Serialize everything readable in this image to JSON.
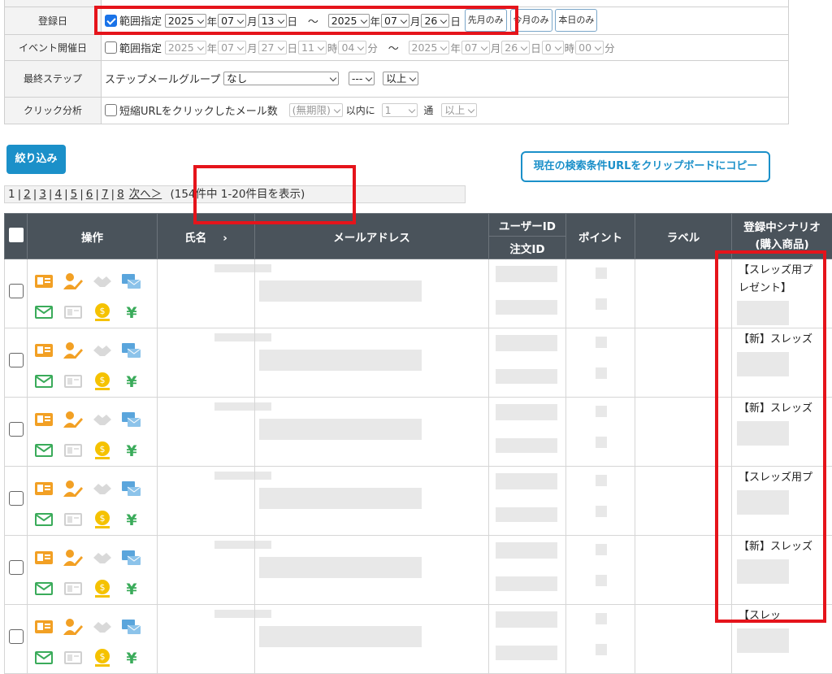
{
  "filters": {
    "reg_label": "登録日",
    "reg_range_label": "範囲指定",
    "reg_from": {
      "year": "2025",
      "month": "07",
      "day": "13"
    },
    "reg_to": {
      "year": "2025",
      "month": "07",
      "day": "26"
    },
    "unit_year": "年",
    "unit_month": "月",
    "unit_day": "日",
    "unit_hour": "時",
    "unit_min": "分",
    "tilde": "～",
    "btn_first_month": "先月のみ",
    "btn_this_month": "今月のみ",
    "btn_today": "本日のみ",
    "event_label": "イベント開催日",
    "event_range_label": "範囲指定",
    "event_from": {
      "year": "2025",
      "month": "07",
      "day": "27",
      "hour": "11",
      "min": "04"
    },
    "event_to": {
      "year": "2025",
      "month": "07",
      "day": "26",
      "hour": "0",
      "min": "00"
    },
    "step_label": "最終ステップ",
    "step_group_label": "ステップメールグループ",
    "step_group_value": "なし",
    "step_num_value": "---",
    "step_cmp_value": "以上",
    "click_label": "クリック分析",
    "click_check_label": "短縮URLをクリックしたメール数",
    "click_period": "(無期限)",
    "click_within": "以内に",
    "click_count": "1",
    "click_unit": "通",
    "click_cmp": "以上"
  },
  "actions": {
    "narrow_label": "絞り込み",
    "copy_url_label": "現在の検索条件URLをクリップボードにコピー"
  },
  "pager": {
    "current": "1",
    "pages": [
      "2",
      "3",
      "4",
      "5",
      "6",
      "7",
      "8"
    ],
    "next_label": "次へ＞",
    "summary": "(154件中 1-20件目を表示)"
  },
  "table": {
    "headers": {
      "ops": "操作",
      "name": "氏名",
      "name_arrow": "›",
      "email": "メールアドレス",
      "user_id": "ユーザーID",
      "order_id": "注文ID",
      "points": "ポイント",
      "label": "ラベル",
      "scenario_1": "登録中シナリオ",
      "scenario_2": "(購入商品)"
    },
    "rows": [
      {
        "scenario_l1": "【スレッズ用プ",
        "scenario_l2": "レゼント】"
      },
      {
        "scenario_l1": "【新】スレッズ",
        "scenario_l2": ""
      },
      {
        "scenario_l1": "【新】スレッズ",
        "scenario_l2": ""
      },
      {
        "scenario_l1": "【スレッズ用プ",
        "scenario_l2": ""
      },
      {
        "scenario_l1": "【新】スレッズ",
        "scenario_l2": ""
      },
      {
        "scenario_l1": "【スレッ",
        "scenario_l2": ""
      }
    ]
  },
  "colors": {
    "header_bg": "#4a535b",
    "primary": "#1b90c9",
    "annotation_red": "#e5141b",
    "icon_orange": "#f2a024",
    "icon_blue": "#5aa5dc",
    "icon_green": "#3aab5a",
    "icon_gold": "#f5c200"
  },
  "icons": [
    "id-card-icon",
    "user-edit-icon",
    "handshake-icon",
    "mail-transfer-icon",
    "mail-icon",
    "card-icon",
    "coin-icon",
    "yen-icon"
  ]
}
